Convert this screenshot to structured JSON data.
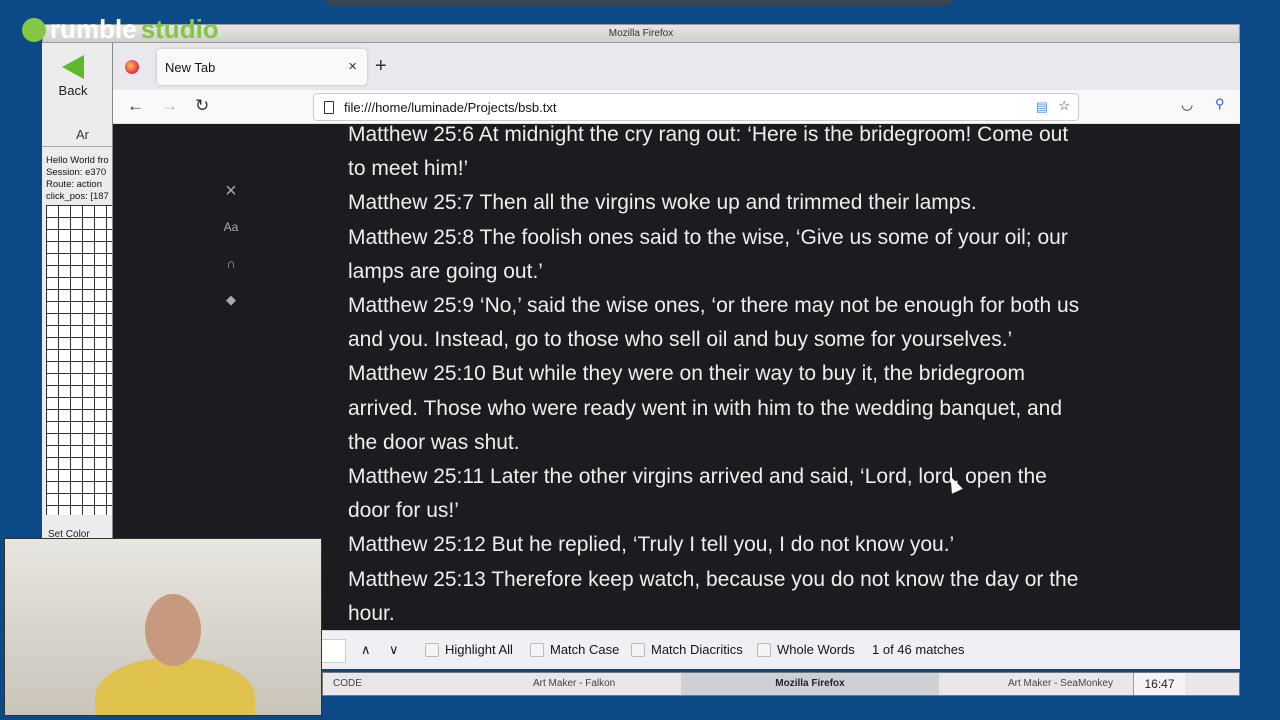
{
  "logo": {
    "brand": "rumble",
    "suffix": "studio"
  },
  "window_title": "Mozilla Firefox",
  "seamonkey": {
    "back_label": "Back",
    "tab_label": "Ar",
    "info_lines": [
      "Hello World fro",
      "Session: e370",
      "Route: action",
      "click_pos: [187"
    ],
    "set_color": "Set Color"
  },
  "tabs": [
    {
      "label": "New Tab",
      "close": "×"
    }
  ],
  "new_tab": "+",
  "nav": {
    "back": "←",
    "forward": "→",
    "reload": "↻",
    "url": "file:///home/luminade/Projects/bsb.txt"
  },
  "reader_side": {
    "close": "×",
    "font": "Aa"
  },
  "verses": [
    "Matthew 25:6 At midnight the cry rang out: ‘Here is the bridegroom! Come out to meet him!’",
    "Matthew 25:7 Then all the virgins woke up and trimmed their lamps.",
    "Matthew 25:8 The foolish ones said to the wise, ‘Give us some of your oil; our lamps are going out.’",
    "Matthew 25:9 ‘No,’ said the wise ones, ‘or there may not be enough for both us and you. Instead, go to those who sell oil and buy some for yourselves.’",
    "Matthew 25:10 But while they were on their way to buy it, the bridegroom arrived. Those who were ready went in with him to the wedding banquet, and the door was shut.",
    "Matthew 25:11 Later the other virgins arrived and said, ‘Lord, lord, open the door for us!’",
    "Matthew 25:12 But he replied, ‘Truly I tell you, I do not know you.’",
    "Matthew 25:13 Therefore keep watch, because you do not know the day or the hour."
  ],
  "findbar": {
    "prev": "∧",
    "next": "∨",
    "options": [
      "Highlight All",
      "Match Case",
      "Match Diacritics",
      "Whole Words"
    ],
    "status": "1 of 46 matches"
  },
  "taskbar": {
    "items": [
      "CODE",
      "Art Maker - Falkon",
      "Mozilla Firefox",
      "Art Maker - SeaMonkey"
    ],
    "clock": "16:47"
  }
}
